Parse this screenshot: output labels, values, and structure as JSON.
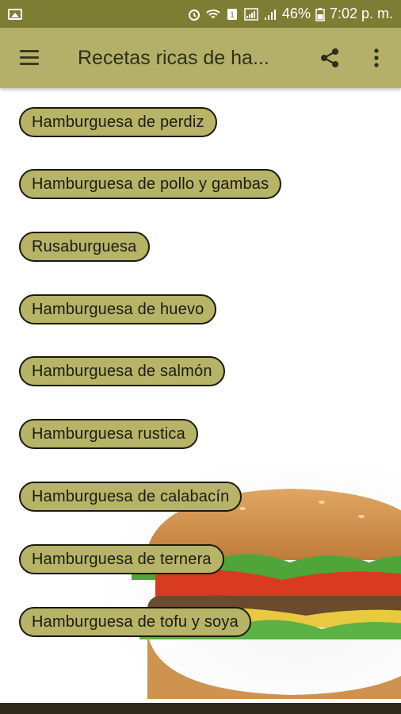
{
  "status_bar": {
    "battery": "46%",
    "time": "7:02 p. m."
  },
  "app_bar": {
    "title": "Recetas ricas de ha..."
  },
  "recipes": [
    "Hamburguesa de perdiz",
    "Hamburguesa de pollo y gambas",
    "Rusaburguesa",
    "Hamburguesa de huevo",
    "Hamburguesa de salmón",
    "Hamburguesa rustica",
    "Hamburguesa de calabacín",
    "Hamburguesa de ternera",
    "Hamburguesa de tofu y soya"
  ],
  "colors": {
    "status_bar": "#7e7d34",
    "app_bar": "#b4b06a",
    "button": "#b7b367"
  }
}
